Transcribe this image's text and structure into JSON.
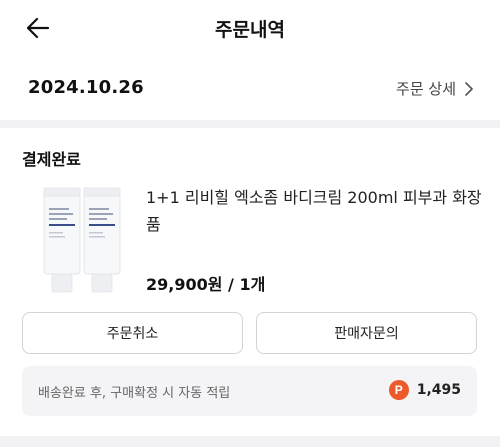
{
  "header": {
    "title": "주문내역",
    "back_icon": "arrow-left-icon"
  },
  "order": {
    "date": "2024.10.26",
    "detail_label": "주문 상세",
    "detail_icon": "chevron-right-icon",
    "status": "결제완료"
  },
  "product": {
    "name": "1+1 리비힐 엑소좀 바디크림 200ml 피부과 화장품",
    "price": "29,900원 / 1개",
    "thumbnail_alt": "body cream tubes"
  },
  "actions": {
    "cancel_label": "주문취소",
    "inquiry_label": "판매자문의"
  },
  "reward": {
    "text": "배송완료 후, 구매확정 시 자동 적립",
    "badge": "P",
    "points": "1,495",
    "badge_color": "#ec5a2a"
  }
}
